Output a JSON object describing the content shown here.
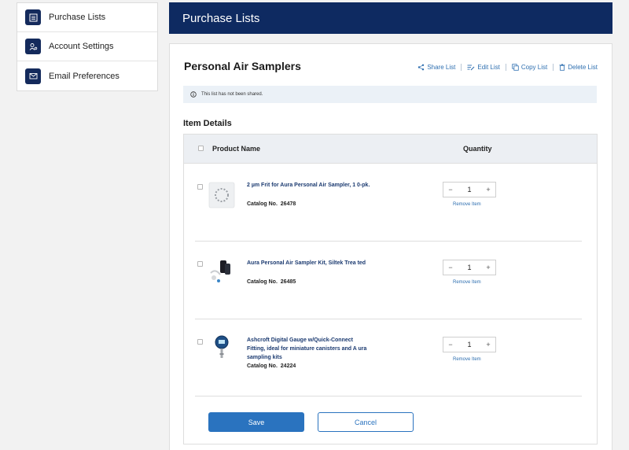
{
  "sidebar": {
    "items": [
      {
        "label": "Purchase Lists",
        "icon": "list-icon"
      },
      {
        "label": "Account Settings",
        "icon": "user-settings-icon"
      },
      {
        "label": "Email Preferences",
        "icon": "envelope-icon"
      }
    ]
  },
  "header": {
    "title": "Purchase Lists"
  },
  "list": {
    "title": "Personal Air Samplers",
    "actions": {
      "share": "Share List",
      "edit": "Edit List",
      "copy": "Copy List",
      "delete": "Delete List"
    },
    "notice": "This list has not been shared."
  },
  "items_section": {
    "title": "Item Details",
    "columns": {
      "product": "Product Name",
      "quantity": "Quantity"
    },
    "remove_label": "Remove Item",
    "catalog_label": "Catalog No.",
    "rows": [
      {
        "name": "2 µm Frit for Aura Personal Air Sampler, 1 0-pk.",
        "catalog": "26478",
        "quantity": "1"
      },
      {
        "name": "Aura Personal Air Sampler Kit, Siltek Trea ted",
        "catalog": "26485",
        "quantity": "1"
      },
      {
        "name": "Ashcroft Digital Gauge w/Quick-Connect Fitting, ideal for miniature canisters and A ura sampling kits",
        "catalog": "24224",
        "quantity": "1"
      }
    ]
  },
  "buttons": {
    "save": "Save",
    "cancel": "Cancel"
  },
  "colors": {
    "navy": "#0e2a61",
    "link": "#2e6fb0",
    "primary": "#2a73bf"
  }
}
